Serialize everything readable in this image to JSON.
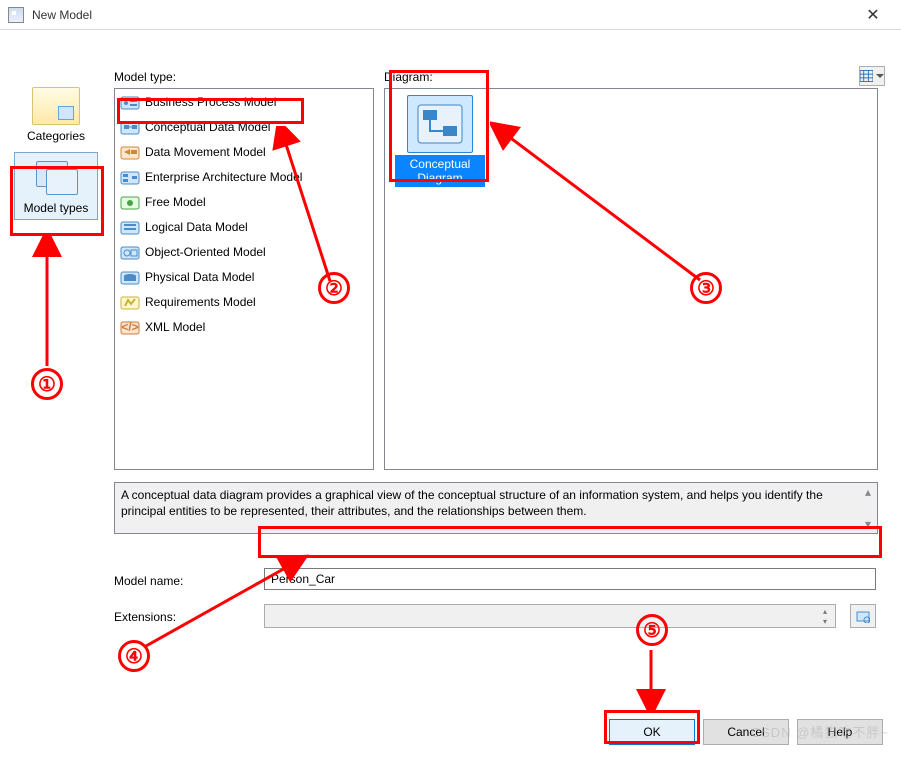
{
  "window": {
    "title": "New Model"
  },
  "nav": {
    "categories_label": "Categories",
    "model_types_label": "Model types",
    "selected": "model_types"
  },
  "labels": {
    "model_type": "Model type:",
    "diagram": "Diagram:",
    "model_name": "Model name:",
    "extensions": "Extensions:"
  },
  "model_types": [
    {
      "label": "Business Process Model"
    },
    {
      "label": "Conceptual Data Model",
      "selected": true
    },
    {
      "label": "Data Movement Model"
    },
    {
      "label": "Enterprise Architecture Model"
    },
    {
      "label": "Free Model"
    },
    {
      "label": "Logical Data Model"
    },
    {
      "label": "Object-Oriented Model"
    },
    {
      "label": "Physical Data Model"
    },
    {
      "label": "Requirements Model"
    },
    {
      "label": "XML Model"
    }
  ],
  "diagram_items": [
    {
      "label": "Conceptual Diagram",
      "selected": true
    }
  ],
  "description": "A conceptual data diagram provides a graphical view of the conceptual structure of an information system, and helps you identify the principal entities to be represented, their attributes, and the relationships between them.",
  "model_name_value": "Person_Car",
  "extensions_value": "",
  "buttons": {
    "ok": "OK",
    "cancel": "Cancel",
    "help": "Help"
  },
  "annotations": [
    "①",
    "②",
    "③",
    "④",
    "⑤"
  ],
  "watermark": "CSDN @橘猫吃不胖~"
}
